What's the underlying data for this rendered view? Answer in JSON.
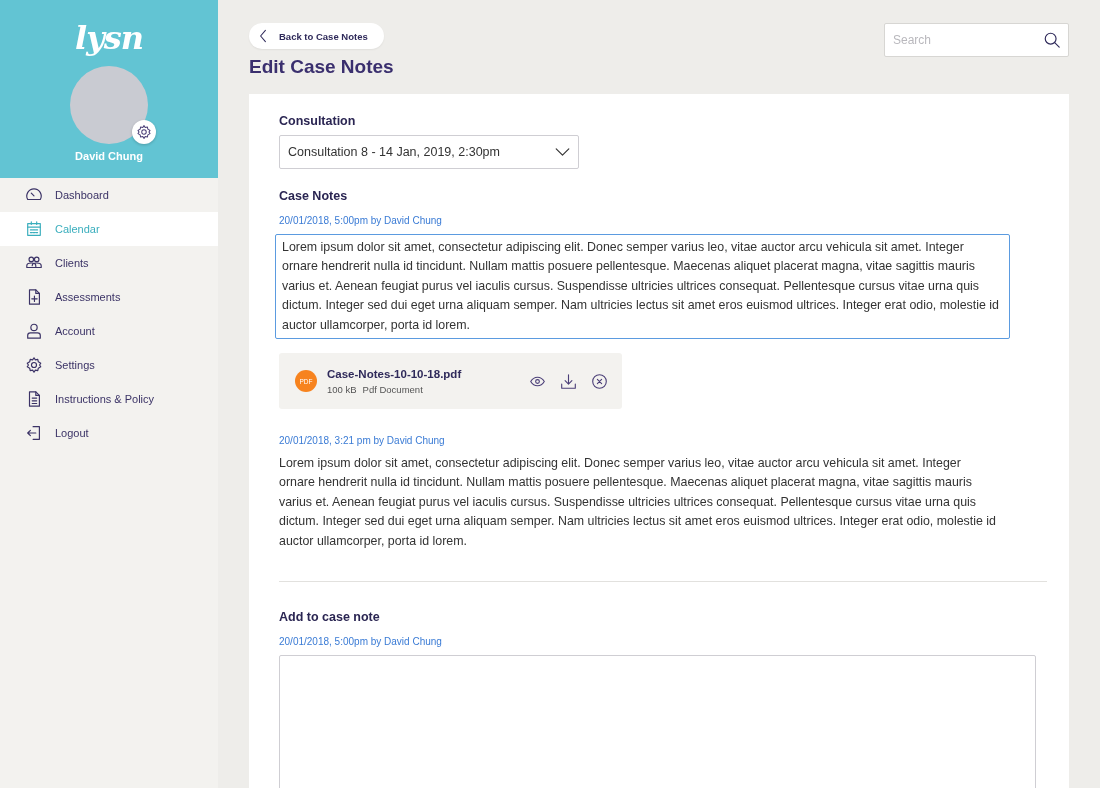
{
  "sidebar": {
    "logo": "lysn",
    "user_name": "David Chung",
    "nav": [
      {
        "label": "Dashboard",
        "selected": false
      },
      {
        "label": "Calendar",
        "selected": true
      },
      {
        "label": "Clients",
        "selected": false
      },
      {
        "label": "Assessments",
        "selected": false
      },
      {
        "label": "Account",
        "selected": false
      },
      {
        "label": "Settings",
        "selected": false
      },
      {
        "label": "Instructions & Policy",
        "selected": false
      },
      {
        "label": "Logout",
        "selected": false
      }
    ]
  },
  "back_button": "Back to Case Notes",
  "search": {
    "placeholder": "Search"
  },
  "title": "Edit Case Notes",
  "consultation": {
    "label": "Consultation",
    "value": "Consultation 8 - 14 Jan, 2019, 2:30pm"
  },
  "case_notes": {
    "heading": "Case Notes",
    "entries": [
      {
        "meta": "20/01/2018, 5:00pm by David Chung",
        "editing": true,
        "text": "Lorem ipsum dolor sit amet, consectetur adipiscing elit. Donec semper varius leo, vitae auctor arcu vehicula sit amet. Integer ornare hendrerit nulla id tincidunt. Nullam mattis posuere pellentesque. Maecenas aliquet placerat magna, vitae sagittis mauris varius et. Aenean feugiat purus vel iaculis cursus. Suspendisse ultricies ultrices consequat. Pellentesque cursus vitae urna quis dictum. Integer sed dui eget urna aliquam semper. Nam ultricies lectus sit amet eros euismod ultrices. Integer erat odio, molestie id auctor ullamcorper, porta id lorem.",
        "attachment": {
          "badge": "PDF",
          "name": "Case-Notes-10-10-18.pdf",
          "size": "100 kB",
          "type": "Pdf Document"
        }
      },
      {
        "meta": "20/01/2018, 3:21 pm by David Chung",
        "editing": false,
        "text": "Lorem ipsum dolor sit amet, consectetur adipiscing elit. Donec semper varius leo, vitae auctor arcu vehicula sit amet. Integer ornare hendrerit nulla id tincidunt. Nullam mattis posuere pellentesque. Maecenas aliquet placerat magna, vitae sagittis mauris varius et. Aenean feugiat purus vel iaculis cursus. Suspendisse ultricies ultrices consequat. Pellentesque cursus vitae urna quis dictum. Integer sed dui eget urna aliquam semper. Nam ultricies lectus sit amet eros euismod ultrices. Integer erat odio, molestie id auctor ullamcorper, porta id lorem."
      }
    ]
  },
  "add_note": {
    "heading": "Add to case note",
    "meta": "20/01/2018, 5:00pm by David Chung"
  }
}
